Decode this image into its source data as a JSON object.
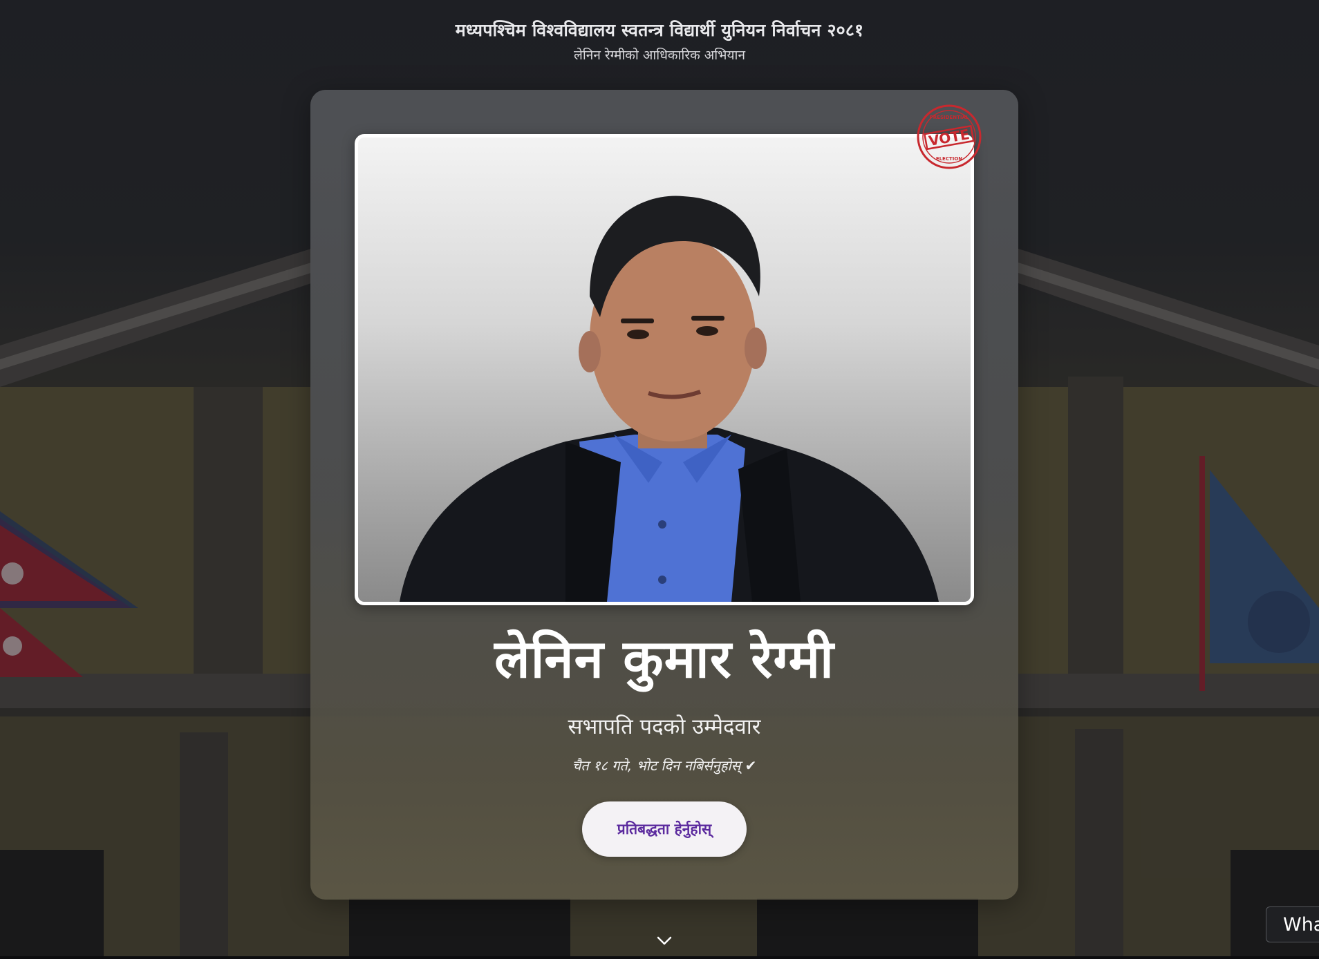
{
  "header": {
    "title": "मध्यपश्चिम विश्वविद्यालय स्वतन्त्र विद्यार्थी युनियन निर्वाचन २०८१",
    "subtitle": "लेनिन रेग्मीको आधिकारिक अभियान"
  },
  "stamp": {
    "top_text": "PRESIDENTIAL",
    "main_text": "VOTE",
    "bottom_text": "ELECTION",
    "color": "#c8282e"
  },
  "candidate": {
    "name": "लेनिन कुमार रेग्मी",
    "role": "सभापति पदको उम्मेदवार",
    "tagline": "चैत १८ गते, भोट दिन नबिर्सनुहोस् ✔"
  },
  "cta": {
    "label": "प्रतिबद्धता हेर्नुहोस्",
    "color": "#5b2a9e"
  },
  "whatsapp": {
    "label": "Wha"
  },
  "icons": {
    "scroll": "chevron-down-icon"
  }
}
